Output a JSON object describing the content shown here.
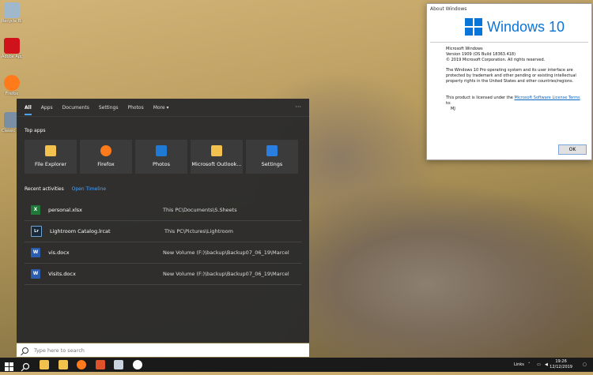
{
  "desktop": {
    "icons": [
      {
        "label": "Recycle Bin",
        "icon": "recycle-bin-icon",
        "color": "#9fb8cc"
      },
      {
        "label": "Adobe Applicati...",
        "icon": "adobe-icon",
        "color": "#d0121b"
      },
      {
        "label": "Firefox",
        "icon": "firefox-icon",
        "color": "#ff7a1a"
      },
      {
        "label": "Classic Shell Netwo...",
        "icon": "classic-shell-icon",
        "color": "#7a8fa3"
      }
    ]
  },
  "about": {
    "title": "About Windows",
    "logo_text": "Windows 10",
    "product": "Microsoft Windows",
    "version": "Version 1909 (OS Build 18363.418)",
    "copyright": "© 2019 Microsoft Corporation. All rights reserved.",
    "legal": "The Windows 10 Pro operating system and its user interface are protected by trademark and other pending or existing intellectual property rights in the United States and other countries/regions.",
    "license_prefix": "This product is licensed under the ",
    "license_link": "Microsoft Software License Terms",
    "license_suffix": " to:",
    "licensee": "MJ",
    "ok_label": "OK"
  },
  "search": {
    "tabs": [
      "All",
      "Apps",
      "Documents",
      "Settings",
      "Photos",
      "More ▾"
    ],
    "more_dots": "···",
    "top_apps_title": "Top apps",
    "top_apps": [
      {
        "name": "File Explorer",
        "icon": "file-explorer-icon",
        "color": "#f2c14e"
      },
      {
        "name": "Firefox",
        "icon": "firefox-icon",
        "color": "#ff7a1a"
      },
      {
        "name": "Photos",
        "icon": "photos-icon",
        "color": "#1f7ad6"
      },
      {
        "name": "Microsoft Outlook...",
        "icon": "outlook-icon",
        "color": "#f2c14e"
      },
      {
        "name": "Settings",
        "icon": "settings-icon",
        "color": "#2a7ee0"
      }
    ],
    "recent_title": "Recent activities",
    "open_timeline": "Open Timeline",
    "recent": [
      {
        "name": "personal.xlsx",
        "path": "This PC\\Documents\\S.Sheets",
        "icon": "excel-icon",
        "glyph": "X",
        "color": "#1f7a3a"
      },
      {
        "name": "Lightroom Catalog.lrcat",
        "path": "This PC\\Pictures\\Lightroom",
        "icon": "lightroom-icon",
        "glyph": "Lr",
        "color": "#1b2a3a"
      },
      {
        "name": "vis.docx",
        "path": "New Volume (F:)\\backup\\Backup07_06_19\\Marcel",
        "icon": "word-icon",
        "glyph": "W",
        "color": "#2b5cad"
      },
      {
        "name": "Visits.docx",
        "path": "New Volume (F:)\\backup\\Backup07_06_19\\Marcel",
        "icon": "word-icon",
        "glyph": "W",
        "color": "#2b5cad"
      }
    ],
    "placeholder": "Type here to search"
  },
  "taskbar": {
    "pinned": [
      {
        "icon": "start-windows-icon",
        "color": "#1a1a1a"
      },
      {
        "icon": "search-icon",
        "color": "#1a1a1a"
      },
      {
        "icon": "file-explorer-icon",
        "color": "#f2c14e"
      },
      {
        "icon": "outlook-icon",
        "color": "#f2c14e"
      },
      {
        "icon": "firefox-icon",
        "color": "#ff7a1a"
      },
      {
        "icon": "app-icon",
        "color": "#e0522a"
      },
      {
        "icon": "window-icon",
        "color": "#c9d4de"
      },
      {
        "icon": "media-icon",
        "color": "#ffffff"
      }
    ],
    "tray_links": "Links",
    "time": "19:26",
    "date": "12/12/2019"
  }
}
